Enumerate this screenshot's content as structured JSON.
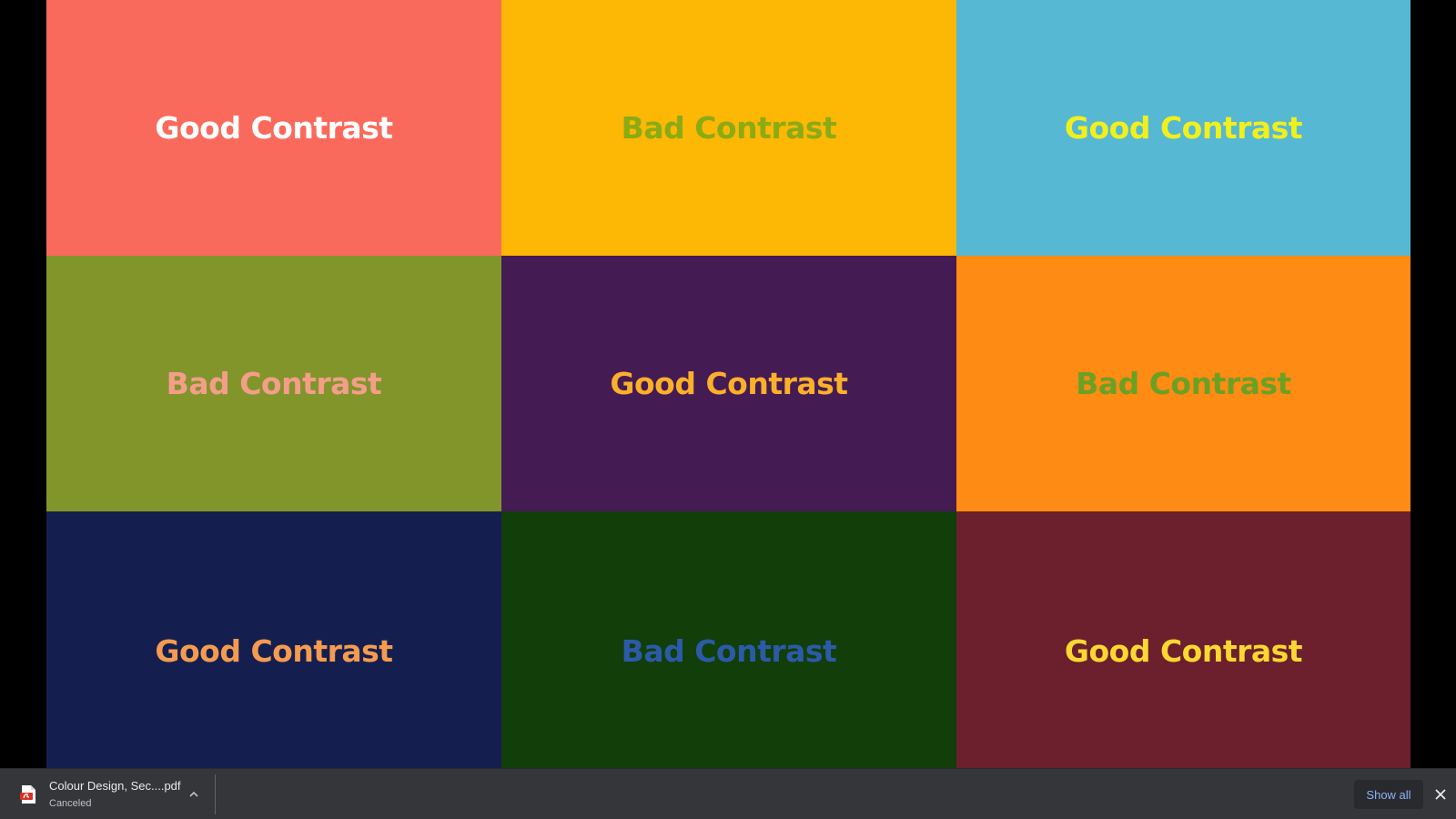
{
  "slide": {
    "tiles": [
      {
        "label": "Good Contrast",
        "bg": "#fa6a5c",
        "fg": "#ffffff"
      },
      {
        "label": "Bad Contrast",
        "bg": "#fdb705",
        "fg": "#8bab15"
      },
      {
        "label": "Good Contrast",
        "bg": "#56b8d3",
        "fg": "#f1f01c"
      },
      {
        "label": "Bad Contrast",
        "bg": "#81952b",
        "fg": "#f49e8a"
      },
      {
        "label": "Good Contrast",
        "bg": "#441b53",
        "fg": "#fbaf2a"
      },
      {
        "label": "Bad Contrast",
        "bg": "#fe8b13",
        "fg": "#6aa125"
      },
      {
        "label": "Good Contrast",
        "bg": "#151f4f",
        "fg": "#f49b50"
      },
      {
        "label": "Bad Contrast",
        "bg": "#123e0a",
        "fg": "#2b5aa9"
      },
      {
        "label": "Good Contrast",
        "bg": "#6c1f2c",
        "fg": "#fad731"
      }
    ]
  },
  "download_bar": {
    "item": {
      "filename": "Colour Design, Sec....pdf",
      "status": "Canceled",
      "icon": "pdf-file-icon"
    },
    "show_all_label": "Show all",
    "close_icon": "close-icon",
    "expand_icon": "chevron-up-icon",
    "accent_color": "#8ab4f8"
  }
}
